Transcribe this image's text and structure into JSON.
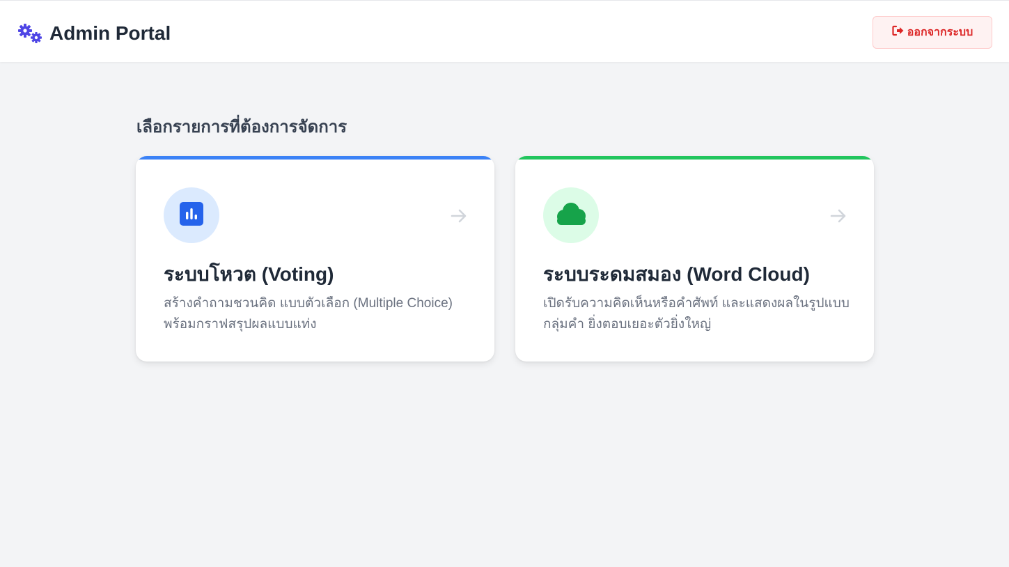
{
  "header": {
    "brand_icon": "gears-icon",
    "title": "Admin Portal",
    "logout_label": "ออกจากระบบ",
    "logout_icon": "sign-out-icon"
  },
  "main": {
    "section_title": "เลือกรายการที่ต้องการจัดการ",
    "cards": [
      {
        "icon": "bar-chart-icon",
        "title": "ระบบโหวต (Voting)",
        "description": "สร้างคำถามชวนคิด แบบตัวเลือก (Multiple Choice) พร้อมกราฟสรุปผลแบบแท่ง",
        "accent": "#3b82f6"
      },
      {
        "icon": "cloud-icon",
        "title": "ระบบระดมสมอง (Word Cloud)",
        "description": "เปิดรับความคิดเห็นหรือคำศัพท์ และแสดงผลในรูปแบบกลุ่มคำ ยิ่งตอบเยอะตัวยิ่งใหญ่",
        "accent": "#22c55e"
      }
    ]
  },
  "colors": {
    "brand_icon": "#4f46e5",
    "danger": "#dc2626",
    "blue": "#2563eb",
    "green": "#16a34a",
    "background": "#f3f4f6"
  }
}
